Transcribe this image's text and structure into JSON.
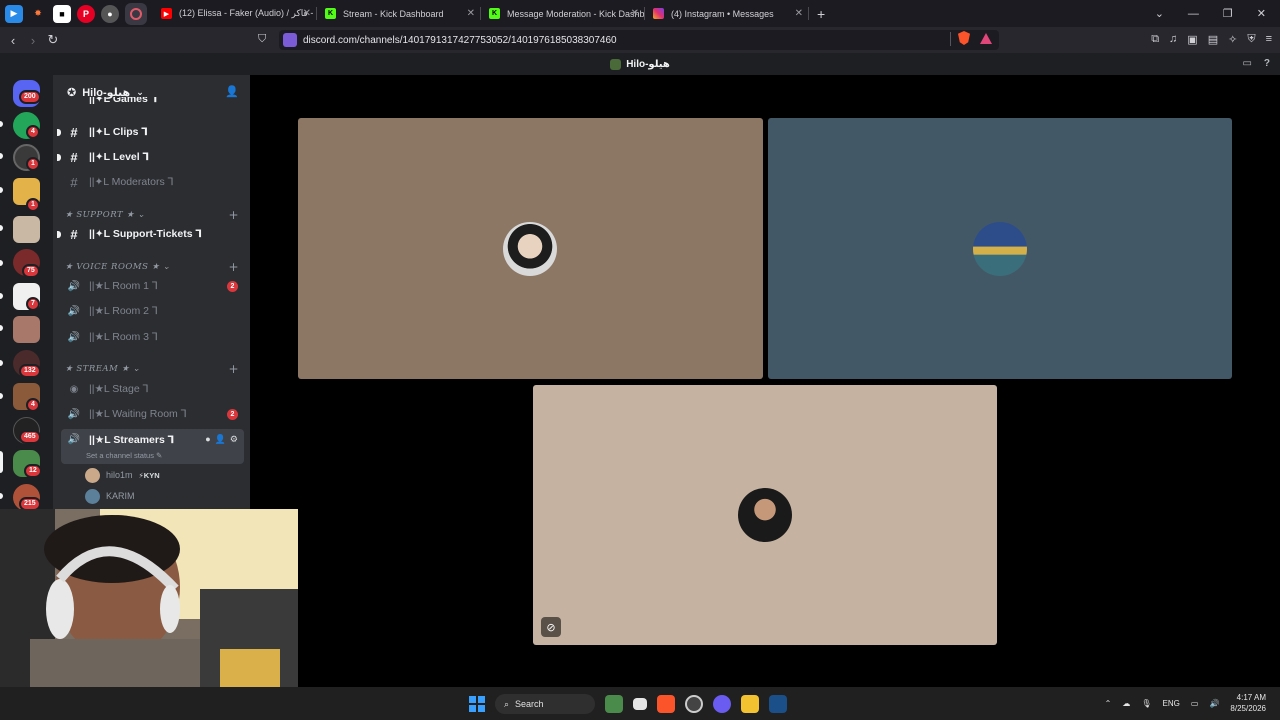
{
  "browser": {
    "tabs": [
      {
        "title": "(12) Elissa - Faker (Audio) / إليسا - فاكر",
        "icon": "youtube-icon",
        "color": "#ff0000"
      },
      {
        "title": "Stream - Kick Dashboard",
        "icon": "kick-icon",
        "color": "#53fc18"
      },
      {
        "title": "Message Moderation - Kick Dashboa",
        "icon": "kick-icon",
        "color": "#53fc18"
      },
      {
        "title": "(4) Instagram • Messages",
        "icon": "instagram-icon",
        "color": "#e1306c"
      }
    ],
    "url": "discord.com/channels/1401791317427753052/1401976185038307460"
  },
  "discord": {
    "window_title": "Hilo-هيلو",
    "server_name": "Hilo-هيلو",
    "rail_badges": [
      "200",
      "4",
      "1",
      "1",
      "75",
      "7",
      "132",
      "4",
      "465",
      "12",
      "215"
    ],
    "channels": {
      "partial_top": "||✦L Games ⅂",
      "clips": "||✦L Clips ⅂",
      "level": "||✦L Level ⅂",
      "moderators": "||✦L Moderators ⅂",
      "cat_support": "★ SUPPORT ★",
      "support_tickets": "||✦L Support-Tickets ⅂",
      "cat_voice": "★ VOICE ROOMS ★",
      "room1": "||★L Room 1 ⅂",
      "room1_badge": "2",
      "room2": "||★L Room 2 ⅂",
      "room3": "||★L Room 3 ⅂",
      "cat_stream": "★ STREAM ★",
      "stage": "||★L Stage ⅂",
      "waiting_room": "||★L Waiting Room ⅂",
      "waiting_badge": "2",
      "streamers": "||★L Streamers ⅂",
      "status_placeholder": "Set a channel status"
    },
    "voice_users": [
      {
        "name": "hilo1m",
        "tag": "⚡KYN"
      },
      {
        "name": "KARIM",
        "tag": ""
      }
    ]
  },
  "taskbar": {
    "search_label": "Search",
    "lang": "ENG",
    "time": "4:17 AM",
    "date": "8/25/2026"
  }
}
